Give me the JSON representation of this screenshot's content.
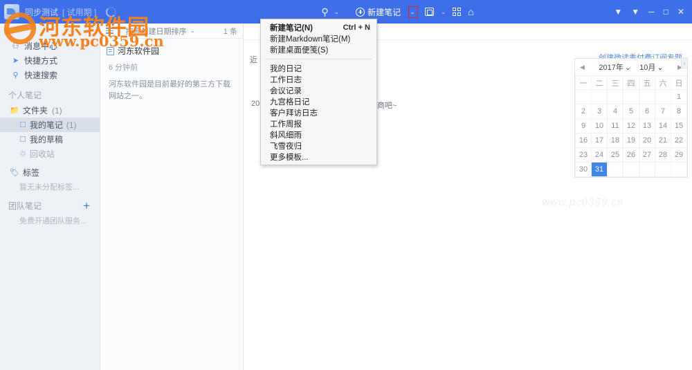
{
  "titlebar": {
    "app_title": "同步测试",
    "trial_label": "[ 试用期 ]",
    "search_icon": "search-icon",
    "search_caret": "⌄",
    "new_note_label": "新建笔记",
    "new_note_caret": "⌄",
    "layout_caret": "⌄",
    "home_icon": "⌂",
    "win_pin": "▼",
    "win_down": "▼",
    "win_min": "─",
    "win_max": "□",
    "win_close": "✕"
  },
  "sidebar": {
    "top_items": [
      {
        "label": "消息中心",
        "icon": "bell-icon",
        "glyph": "♛"
      },
      {
        "label": "快捷方式",
        "icon": "rocket-icon",
        "glyph": "✈"
      },
      {
        "label": "快速搜索",
        "icon": "search-icon",
        "glyph": "⌕"
      }
    ],
    "personal_group": "个人笔记",
    "folders_label": "文件夹",
    "folders_count": "(1)",
    "folder_items": [
      {
        "label": "我的笔记",
        "count": "(1)",
        "selected": true
      },
      {
        "label": "我的草稿",
        "count": "",
        "selected": false
      }
    ],
    "trash_label": "回收站",
    "tags_label": "标签",
    "tags_hint": "暂无未分配标签...",
    "team_group": "团队笔记",
    "team_plus": "+",
    "team_hint": "免费开通团队服务..."
  },
  "notelist": {
    "sort_label": "按照创建日期排序",
    "sort_caret": "⌄",
    "count_label": "1 条",
    "items": [
      {
        "title": "河东软件园",
        "time": "6 分钟前",
        "snippet": "河东软件园是目前最好的第三方下载网站之一。"
      }
    ]
  },
  "menu": {
    "items": [
      {
        "label": "新建笔记(N)",
        "shortcut": "Ctrl + N",
        "strong": true
      },
      {
        "label": "新建Markdown笔记(M)",
        "shortcut": "",
        "strong": false
      },
      {
        "label": "新建桌面便笺(S)",
        "shortcut": "",
        "strong": false
      },
      {
        "separator": true
      },
      {
        "label": "我的日记",
        "shortcut": "",
        "strong": false
      },
      {
        "label": "工作日志",
        "shortcut": "",
        "strong": false
      },
      {
        "label": "会议记录",
        "shortcut": "",
        "strong": false
      },
      {
        "label": "九宫格日记",
        "shortcut": "",
        "strong": false
      },
      {
        "label": "客户拜访日志",
        "shortcut": "",
        "strong": false
      },
      {
        "label": "工作周报",
        "shortcut": "",
        "strong": false
      },
      {
        "label": "斜风细雨",
        "shortcut": "",
        "strong": false
      },
      {
        "label": "飞雪夜归",
        "shortcut": "",
        "strong": false
      },
      {
        "label": "更多模板...",
        "shortcut": "",
        "strong": false
      }
    ]
  },
  "editor": {
    "promo_label": "创建微读季付费订阅专题",
    "fragment_left": "近",
    "fragment_date": "201",
    "fragment_right": "商吧~",
    "watermark": "www.pc0359.cn"
  },
  "calendar": {
    "prev_arrow": "◀",
    "next_arrow": "▶",
    "scroll_glyph": "›",
    "year": "2017年",
    "month": "10月",
    "caret": "⌄",
    "weekdays": [
      "一",
      "二",
      "三",
      "四",
      "五",
      "六",
      "日"
    ],
    "weeks": [
      [
        "",
        "",
        "",
        "",
        "",
        "",
        "1"
      ],
      [
        "2",
        "3",
        "4",
        "5",
        "6",
        "7",
        "8"
      ],
      [
        "9",
        "10",
        "11",
        "12",
        "13",
        "14",
        "15"
      ],
      [
        "16",
        "17",
        "18",
        "19",
        "20",
        "21",
        "22"
      ],
      [
        "23",
        "24",
        "25",
        "26",
        "27",
        "28",
        "29"
      ],
      [
        "30",
        "31",
        "",
        "",
        "",
        "",
        ""
      ]
    ],
    "today": "31"
  },
  "watermark": {
    "site_cn": "河东软件园",
    "site_url": "www.pc0359.cn"
  },
  "colors": {
    "titlebar": "#3f6fe8",
    "sidebar": "#eef1f6",
    "accent": "#3f86e8",
    "watermark": "#f58220",
    "highlight_box": "#d92b2b"
  }
}
